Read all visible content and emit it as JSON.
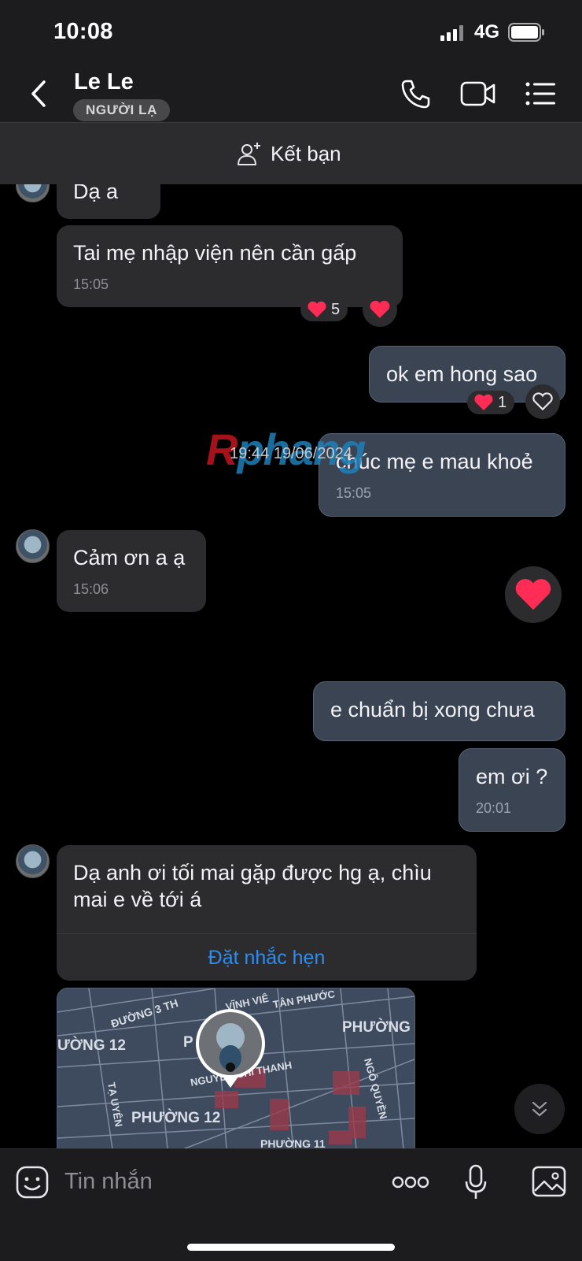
{
  "status_bar": {
    "time": "10:08",
    "network": "4G"
  },
  "header": {
    "contact_name": "Le Le",
    "badge": "NGƯỜI LẠ",
    "add_friend_label": "Kết bạn"
  },
  "messages": [
    {
      "direction": "in",
      "text": "Dạ a"
    },
    {
      "direction": "in",
      "text": "Tai mẹ nhập viện nên cần gấp",
      "time": "15:05",
      "reaction_count": "5"
    },
    {
      "direction": "out",
      "text": "ok em hong sao",
      "reaction_count": "1"
    },
    {
      "direction": "out",
      "text": "chúc mẹ e mau khoẻ",
      "time": "15:05"
    },
    {
      "direction": "in",
      "text": "Cảm ơn a ạ",
      "time": "15:06"
    },
    {
      "direction": "out",
      "text": "e chuẩn bị xong chưa"
    },
    {
      "direction": "out",
      "text": "em ơi ?",
      "time": "20:01"
    },
    {
      "direction": "in",
      "text": "Dạ anh ơi tối mai gặp được hg ạ, chìu mai e về tới á",
      "action": "Đặt nhắc hẹn"
    }
  ],
  "date_divider": "19:44 19/06/2024",
  "watermark": {
    "red": "R",
    "blue": "phang"
  },
  "map_labels": [
    "ĐƯỜNG 3 TH",
    "VĨNH VIÊ",
    "TÂN PHƯỚC",
    "PHƯỜNG",
    "ƯỜNG 12",
    "P",
    "NGUYỄN CHÍ THANH",
    "NGÔ QUYỀN",
    "TẠ UYÊN",
    "PHƯỜNG 12",
    "PHƯỜNG 11"
  ],
  "composer": {
    "placeholder": "Tin nhắn"
  },
  "colors": {
    "accent": "#2d8cf0",
    "heart": "#ff2d55",
    "out_bubble": "#3a4453",
    "in_bubble": "#2c2c2e"
  }
}
